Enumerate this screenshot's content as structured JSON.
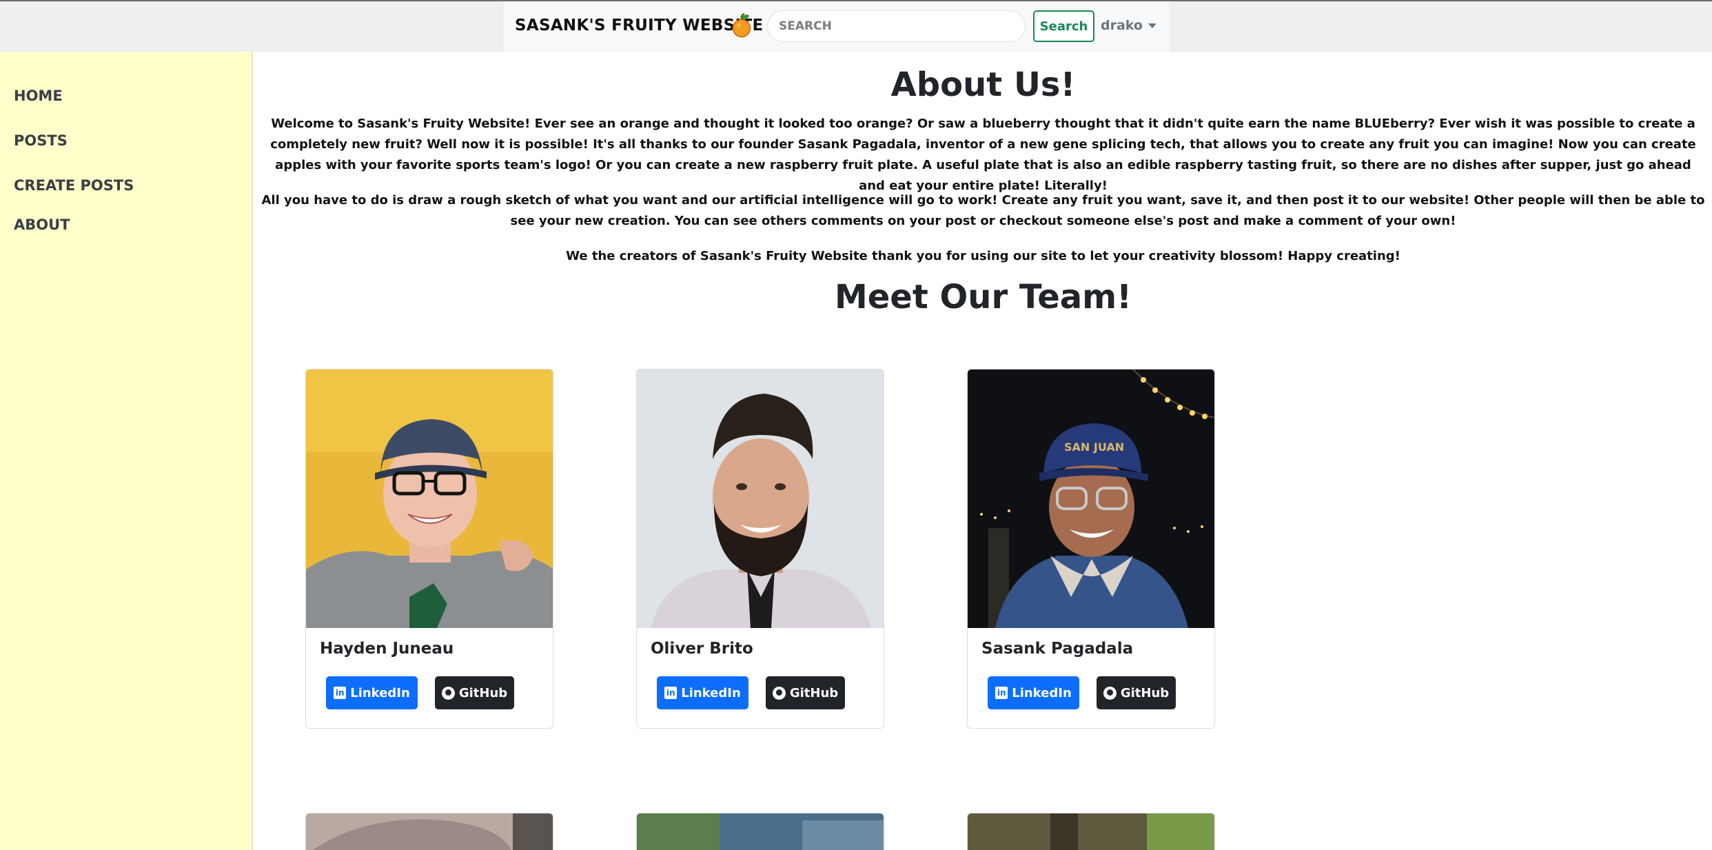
{
  "header": {
    "brand": "SASANK'S FRUITY WEBSITE",
    "search_placeholder": "SEARCH",
    "search_button": "Search",
    "user": "drako"
  },
  "sidebar": {
    "items": [
      {
        "label": "HOME"
      },
      {
        "label": "POSTS"
      },
      {
        "label": "CREATE POSTS"
      },
      {
        "label": "ABOUT"
      }
    ]
  },
  "about": {
    "title": "About Us!",
    "p1": "Welcome to Sasank's Fruity Website! Ever see an orange and thought it looked too orange? Or saw a blueberry thought that it didn't quite earn the name BLUEberry? Ever wish it was possible to create a completely new fruit? Well now it is possible! It's all thanks to our founder Sasank Pagadala, inventor of a new gene splicing tech, that allows you to create any fruit you can imagine! Now you can create apples with your favorite sports team's logo! Or you can create a new raspberry fruit plate. A useful plate that is also an edible raspberry tasting fruit, so there are no dishes after supper, just go ahead and eat your entire plate! Literally!",
    "p2": "All you have to do is draw a rough sketch of what you want and our artificial intelligence will go to work! Create any fruit you want, save it, and then post it to our website! Other people will then be able to see your new creation. You can see others comments on your post or checkout someone else's post and make a comment of your own!",
    "p3": "We the creators of Sasank's Fruity Website thank you for using our site to let your creativity blossom! Happy creating!"
  },
  "team": {
    "title": "Meet Our Team!",
    "members": [
      {
        "name": "Hayden Juneau",
        "linkedin": "LinkedIn",
        "github": "GitHub"
      },
      {
        "name": "Oliver Brito",
        "linkedin": "LinkedIn",
        "github": "GitHub"
      },
      {
        "name": "Sasank Pagadala",
        "linkedin": "LinkedIn",
        "github": "GitHub"
      }
    ]
  },
  "colors": {
    "sidebar_bg": "#ffffcc",
    "linkedin_btn": "#0d6efd",
    "github_btn": "#212529",
    "search_btn": "#198754"
  },
  "icons": [
    "orange-icon",
    "linkedin-icon",
    "github-icon",
    "caret-down-icon"
  ]
}
